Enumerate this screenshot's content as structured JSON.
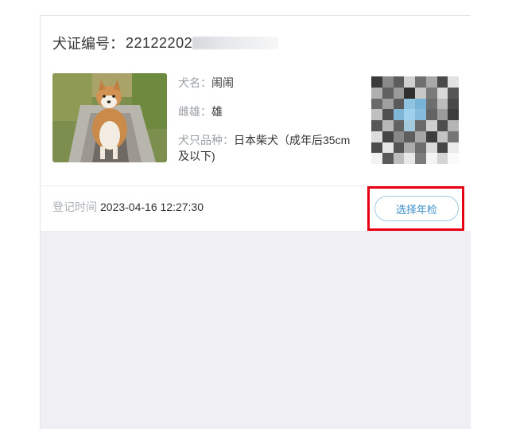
{
  "certificate": {
    "label": "犬证编号：",
    "number_visible": "22122202"
  },
  "dog": {
    "name_label": "犬名：",
    "name_value": "闹闹",
    "sex_label": "雌雄：",
    "sex_value": "雄",
    "breed_label": "犬只品种：",
    "breed_value": "日本柴犬（成年后35cm及以下)"
  },
  "registration": {
    "label": "登记时间",
    "value": "2023-04-16 12:27:30"
  },
  "actions": {
    "annual_inspection_label": "选择年检"
  },
  "colors": {
    "accent_blue": "#3a8fc8",
    "highlight_red": "#e60012"
  }
}
